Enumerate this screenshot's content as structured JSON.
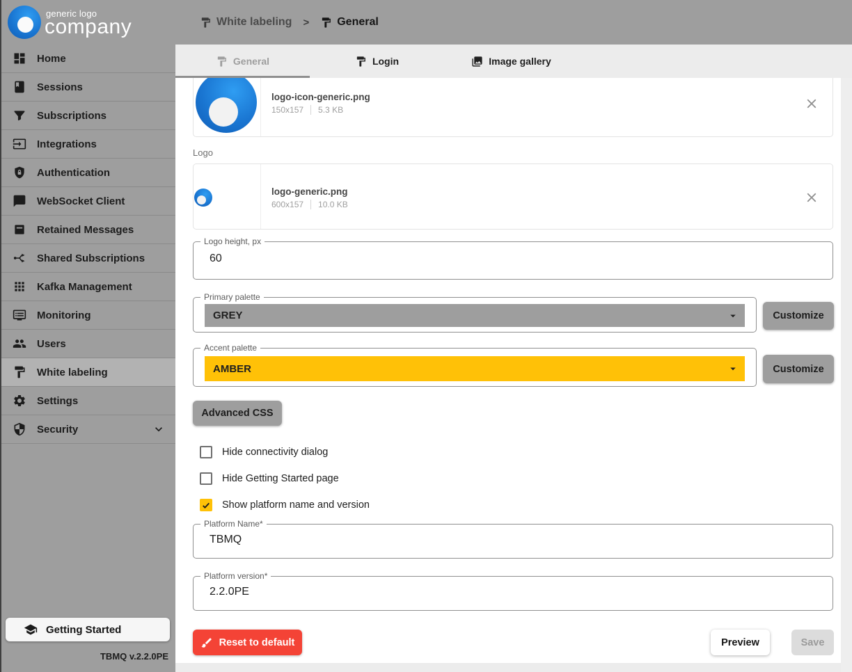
{
  "header": {
    "logo": {
      "line1": "generic logo",
      "line2": "company"
    },
    "breadcrumb": {
      "parent": "White labeling",
      "separator": ">",
      "current": "General"
    }
  },
  "tabs": {
    "general": "General",
    "login": "Login",
    "image_gallery": "Image gallery"
  },
  "sidebar": {
    "items": [
      {
        "label": "Home",
        "icon": "dashboard"
      },
      {
        "label": "Sessions",
        "icon": "book"
      },
      {
        "label": "Subscriptions",
        "icon": "filter"
      },
      {
        "label": "Integrations",
        "icon": "input"
      },
      {
        "label": "Authentication",
        "icon": "shield-lock"
      },
      {
        "label": "WebSocket Client",
        "icon": "chat-bubble"
      },
      {
        "label": "Retained Messages",
        "icon": "archive-box"
      },
      {
        "label": "Shared Subscriptions",
        "icon": "split-arrows"
      },
      {
        "label": "Kafka Management",
        "icon": "grid"
      },
      {
        "label": "Monitoring",
        "icon": "monitor"
      },
      {
        "label": "Users",
        "icon": "people"
      },
      {
        "label": "White labeling",
        "icon": "paint-roller",
        "selected": true
      },
      {
        "label": "Settings",
        "icon": "gear"
      },
      {
        "label": "Security",
        "icon": "shield",
        "expandable": true
      }
    ],
    "getting_started": "Getting Started",
    "version": "TBMQ v.2.2.0PE"
  },
  "form": {
    "logo_icon_card": {
      "filename": "logo-icon-generic.png",
      "dimensions": "150x157",
      "size": "5.3 KB"
    },
    "logo_section_label": "Logo",
    "logo_card": {
      "filename": "logo-generic.png",
      "dimensions": "600x157",
      "size": "10.0 KB"
    },
    "logo_height": {
      "label": "Logo height, px",
      "value": "60"
    },
    "primary_palette": {
      "label": "Primary palette",
      "value": "GREY",
      "swatch_color": "#9e9e9e",
      "customize": "Customize"
    },
    "accent_palette": {
      "label": "Accent palette",
      "value": "AMBER",
      "swatch_color": "#ffc107",
      "customize": "Customize"
    },
    "advanced_css": "Advanced CSS",
    "checkboxes": [
      {
        "label": "Hide connectivity dialog",
        "checked": false
      },
      {
        "label": "Hide Getting Started page",
        "checked": false
      },
      {
        "label": "Show platform name and version",
        "checked": true
      }
    ],
    "platform_name": {
      "label": "Platform Name*",
      "value": "TBMQ"
    },
    "platform_version": {
      "label": "Platform version*",
      "value": "2.2.0PE"
    },
    "actions": {
      "reset": "Reset to default",
      "preview": "Preview",
      "save": "Save"
    }
  },
  "colors": {
    "header_grey": "#9e9e9e",
    "selected_item_grey": "#b2b2b2",
    "accent_amber": "#ffc107",
    "danger_red": "#f44336",
    "tabstrip_bg": "#ececec",
    "logo_blue": "#1a76d2"
  }
}
